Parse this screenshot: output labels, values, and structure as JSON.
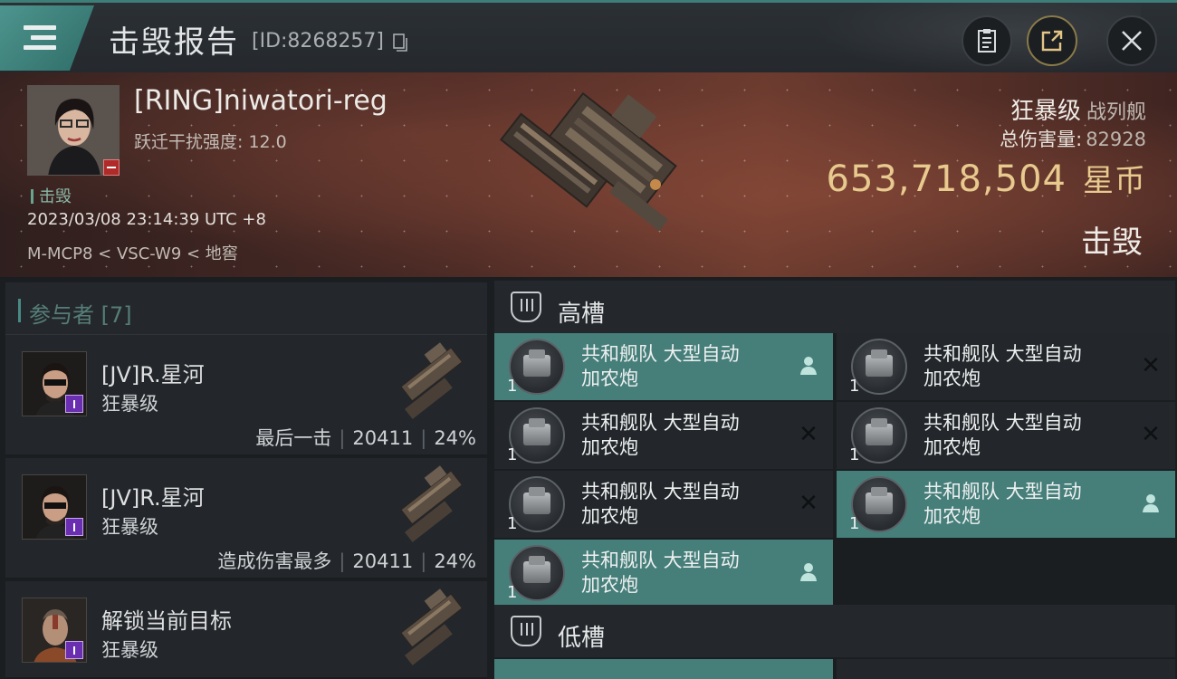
{
  "header": {
    "title": "击毁报告",
    "report_id": "[ID:8268257]"
  },
  "victim": {
    "name": "[RING]niwatori-reg",
    "warp_scramble_label": "跃迁干扰强度: 12.0",
    "status_tag": "击毁",
    "time": "2023/03/08 23:14:39 UTC +8",
    "location": "M-MCP8 < VSC-W9 < 地窖",
    "ship_name": "狂暴级",
    "ship_class": "战列舰",
    "damage_label": "总伤害量:",
    "damage_value": "82928",
    "isk_value": "653,718,504",
    "isk_unit": "星币",
    "result": "击毁"
  },
  "participants": {
    "label": "参与者 [7]",
    "rows": [
      {
        "name": "[JV]R.星河",
        "ship": "狂暴级",
        "tag": "最后一击",
        "damage": "20411",
        "percent": "24%"
      },
      {
        "name": "[JV]R.星河",
        "ship": "狂暴级",
        "tag": "造成伤害最多",
        "damage": "20411",
        "percent": "24%"
      },
      {
        "name": "解锁当前目标",
        "ship": "狂暴级"
      }
    ]
  },
  "fitting": {
    "high_label": "高槽",
    "low_label": "低槽",
    "high_slots": [
      {
        "name_line1": "共和舰队 大型自动",
        "name_line2": "加农炮",
        "qty": "1",
        "state": "dropped"
      },
      {
        "name_line1": "共和舰队 大型自动",
        "name_line2": "加农炮",
        "qty": "1",
        "state": "destroyed"
      },
      {
        "name_line1": "共和舰队 大型自动",
        "name_line2": "加农炮",
        "qty": "1",
        "state": "destroyed"
      },
      {
        "name_line1": "共和舰队 大型自动",
        "name_line2": "加农炮",
        "qty": "1",
        "state": "destroyed"
      },
      {
        "name_line1": "共和舰队 大型自动",
        "name_line2": "加农炮",
        "qty": "1",
        "state": "destroyed"
      },
      {
        "name_line1": "共和舰队 大型自动",
        "name_line2": "加农炮",
        "qty": "1",
        "state": "dropped"
      },
      {
        "name_line1": "共和舰队 大型自动",
        "name_line2": "加农炮",
        "qty": "1",
        "state": "dropped"
      }
    ]
  },
  "icons": {
    "menu": "hamburger-menu-icon",
    "copy": "copy-icon",
    "clipboard": "clipboard-icon",
    "share": "share-icon",
    "close": "close-icon",
    "high_slot": "high-slot-icon",
    "low_slot": "low-slot-icon",
    "dropped": "person-icon",
    "destroyed": "x-mark-icon"
  },
  "colors": {
    "accent_teal": "#467f7a",
    "isk_gold": "#e8c98e",
    "loss_red": "#b02a2a",
    "corp_purple": "#6a2fb0"
  }
}
